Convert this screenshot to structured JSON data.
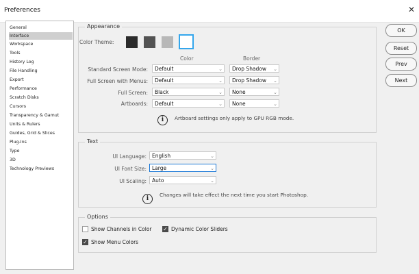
{
  "window": {
    "title": "Preferences",
    "close_glyph": "✕"
  },
  "sidebar": {
    "items": [
      {
        "label": "General"
      },
      {
        "label": "Interface",
        "selected": true
      },
      {
        "label": "Workspace"
      },
      {
        "label": "Tools"
      },
      {
        "label": "History Log"
      },
      {
        "label": "File Handling"
      },
      {
        "label": "Export"
      },
      {
        "label": "Performance"
      },
      {
        "label": "Scratch Disks"
      },
      {
        "label": "Cursors"
      },
      {
        "label": "Transparency & Gamut"
      },
      {
        "label": "Units & Rulers"
      },
      {
        "label": "Guides, Grid & Slices"
      },
      {
        "label": "Plug-Ins"
      },
      {
        "label": "Type"
      },
      {
        "label": "3D"
      },
      {
        "label": "Technology Previews"
      }
    ]
  },
  "appearance": {
    "legend": "Appearance",
    "color_theme_label": "Color Theme:",
    "themes": [
      {
        "color": "#2b2b2b"
      },
      {
        "color": "#535353"
      },
      {
        "color": "#b8b8b8"
      },
      {
        "color": "#ffffff",
        "selected": true
      }
    ],
    "col_color": "Color",
    "col_border": "Border",
    "rows": [
      {
        "label": "Standard Screen Mode:",
        "color": "Default",
        "border": "Drop Shadow"
      },
      {
        "label": "Full Screen with Menus:",
        "color": "Default",
        "border": "Drop Shadow"
      },
      {
        "label": "Full Screen:",
        "color": "Black",
        "border": "None"
      },
      {
        "label": "Artboards:",
        "color": "Default",
        "border": "None"
      }
    ],
    "note": "Artboard settings only apply to GPU RGB mode."
  },
  "text": {
    "legend": "Text",
    "ui_language_label": "UI Language:",
    "ui_language": "English",
    "ui_font_size_label": "UI Font Size:",
    "ui_font_size": "Large",
    "ui_scaling_label": "UI Scaling:",
    "ui_scaling": "Auto",
    "note": "Changes will take effect the next time you start Photoshop."
  },
  "options": {
    "legend": "Options",
    "show_channels": {
      "label": "Show Channels in Color",
      "checked": false
    },
    "dynamic_sliders": {
      "label": "Dynamic Color Sliders",
      "checked": true
    },
    "show_menu_colors": {
      "label": "Show Menu Colors",
      "checked": true
    }
  },
  "buttons": {
    "ok": "OK",
    "reset": "Reset",
    "prev": "Prev",
    "next": "Next"
  },
  "icons": {
    "info": "info-circle-icon",
    "dropdown": "chevron-down-icon",
    "check": "✓",
    "chevron": "⌄"
  }
}
